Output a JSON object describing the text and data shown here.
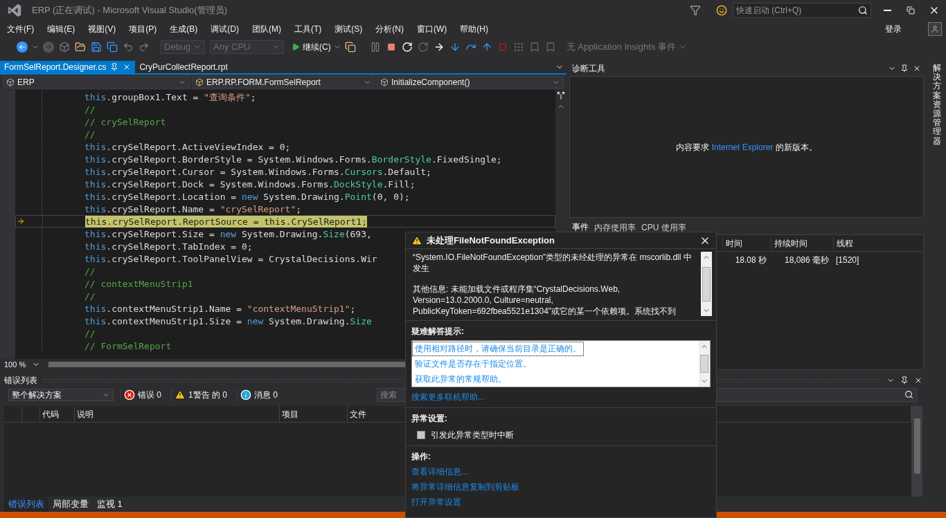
{
  "window": {
    "title": "ERP (正在调试) - Microsoft Visual Studio(管理员)",
    "quick_launch": {
      "placeholder": "快速启动 (Ctrl+Q)"
    }
  },
  "menu": {
    "items": [
      "文件(F)",
      "编辑(E)",
      "视图(V)",
      "项目(P)",
      "生成(B)",
      "调试(D)",
      "团队(M)",
      "工具(T)",
      "测试(S)",
      "分析(N)",
      "窗口(W)",
      "帮助(H)"
    ],
    "sign_in": "登录"
  },
  "toolbar": {
    "config": {
      "value": "Debug",
      "disabled": true
    },
    "platform": {
      "value": "Any CPU",
      "disabled": true
    },
    "continue": "继续(C)",
    "insights": {
      "value": "无 Application Insights 事件",
      "disabled": true
    }
  },
  "editor": {
    "tabs": [
      {
        "label": "FormSelReport.Designer.cs",
        "selected": true
      },
      {
        "label": "CryPurCollectReport.rpt",
        "selected": false
      }
    ],
    "nav": [
      "ERP",
      "ERP.RP.FORM.FormSelReport",
      "InitializeComponent()"
    ],
    "lines": [
      {
        "current": false,
        "tokens": [
          {
            "text": "this",
            "kind": "keyword"
          },
          {
            "text": ".groupBox1.Text = ",
            "kind": "plain"
          },
          {
            "text": "\"查询条件\"",
            "kind": "string"
          },
          {
            "text": ";",
            "kind": "plain"
          }
        ]
      },
      {
        "current": false,
        "tokens": [
          {
            "text": "//",
            "kind": "comment"
          }
        ]
      },
      {
        "current": false,
        "tokens": [
          {
            "text": "// crySelReport",
            "kind": "comment"
          }
        ]
      },
      {
        "current": false,
        "tokens": [
          {
            "text": "//",
            "kind": "comment"
          }
        ]
      },
      {
        "current": false,
        "tokens": [
          {
            "text": "this",
            "kind": "keyword"
          },
          {
            "text": ".crySelReport.ActiveViewIndex = 0;",
            "kind": "plain"
          }
        ]
      },
      {
        "current": false,
        "tokens": [
          {
            "text": "this",
            "kind": "keyword"
          },
          {
            "text": ".crySelReport.BorderStyle = System.Windows.Forms.",
            "kind": "plain"
          },
          {
            "text": "BorderStyle",
            "kind": "type"
          },
          {
            "text": ".FixedSingle;",
            "kind": "plain"
          }
        ]
      },
      {
        "current": false,
        "tokens": [
          {
            "text": "this",
            "kind": "keyword"
          },
          {
            "text": ".crySelReport.Cursor = System.Windows.Forms.",
            "kind": "plain"
          },
          {
            "text": "Cursors",
            "kind": "type"
          },
          {
            "text": ".Default;",
            "kind": "plain"
          }
        ]
      },
      {
        "current": false,
        "tokens": [
          {
            "text": "this",
            "kind": "keyword"
          },
          {
            "text": ".crySelReport.Dock = System.Windows.Forms.",
            "kind": "plain"
          },
          {
            "text": "DockStyle",
            "kind": "type"
          },
          {
            "text": ".Fill;",
            "kind": "plain"
          }
        ]
      },
      {
        "current": false,
        "tokens": [
          {
            "text": "this",
            "kind": "keyword"
          },
          {
            "text": ".crySelReport.Location = ",
            "kind": "plain"
          },
          {
            "text": "new",
            "kind": "keyword"
          },
          {
            "text": " System.Drawing.",
            "kind": "plain"
          },
          {
            "text": "Point",
            "kind": "type"
          },
          {
            "text": "(0, 0);",
            "kind": "plain"
          }
        ]
      },
      {
        "current": false,
        "tokens": [
          {
            "text": "this",
            "kind": "keyword"
          },
          {
            "text": ".crySelReport.Name = ",
            "kind": "plain"
          },
          {
            "text": "\"crySelReport\"",
            "kind": "string"
          },
          {
            "text": ";",
            "kind": "plain"
          }
        ]
      },
      {
        "current": true,
        "tokens": [
          {
            "text": "this",
            "kind": "keyword"
          },
          {
            "text": ".crySelReport.ReportSource = ",
            "kind": "plain"
          },
          {
            "text": "this",
            "kind": "keyword"
          },
          {
            "text": ".CrySelReport1;",
            "kind": "plain"
          }
        ]
      },
      {
        "current": false,
        "tokens": [
          {
            "text": "this",
            "kind": "keyword"
          },
          {
            "text": ".crySelReport.Size = ",
            "kind": "plain"
          },
          {
            "text": "new",
            "kind": "keyword"
          },
          {
            "text": " System.Drawing.",
            "kind": "plain"
          },
          {
            "text": "Size",
            "kind": "type"
          },
          {
            "text": "(693,",
            "kind": "plain"
          }
        ]
      },
      {
        "current": false,
        "tokens": [
          {
            "text": "this",
            "kind": "keyword"
          },
          {
            "text": ".crySelReport.TabIndex = 0;",
            "kind": "plain"
          }
        ]
      },
      {
        "current": false,
        "tokens": [
          {
            "text": "this",
            "kind": "keyword"
          },
          {
            "text": ".crySelReport.ToolPanelView = CrystalDecisions.Wir",
            "kind": "plain"
          }
        ]
      },
      {
        "current": false,
        "tokens": [
          {
            "text": "//",
            "kind": "comment"
          }
        ]
      },
      {
        "current": false,
        "tokens": [
          {
            "text": "// contextMenuStrip1",
            "kind": "comment"
          }
        ]
      },
      {
        "current": false,
        "tokens": [
          {
            "text": "//",
            "kind": "comment"
          }
        ]
      },
      {
        "current": false,
        "tokens": [
          {
            "text": "this",
            "kind": "keyword"
          },
          {
            "text": ".contextMenuStrip1.Name = ",
            "kind": "plain"
          },
          {
            "text": "\"contextMenuStrip1\"",
            "kind": "string"
          },
          {
            "text": ";",
            "kind": "plain"
          }
        ]
      },
      {
        "current": false,
        "tokens": [
          {
            "text": "this",
            "kind": "keyword"
          },
          {
            "text": ".contextMenuStrip1.Size = ",
            "kind": "plain"
          },
          {
            "text": "new",
            "kind": "keyword"
          },
          {
            "text": " System.Drawing.",
            "kind": "plain"
          },
          {
            "text": "Size",
            "kind": "type"
          }
        ]
      },
      {
        "current": false,
        "tokens": [
          {
            "text": "//",
            "kind": "comment"
          }
        ]
      },
      {
        "current": false,
        "tokens": [
          {
            "text": "// FormSelReport",
            "kind": "comment"
          }
        ]
      }
    ],
    "zoom": "100 %"
  },
  "diagnostics": {
    "title": "诊断工具",
    "message": {
      "before": "内容要求 ",
      "link": "Internet Explorer",
      "after": " 的新版本。"
    },
    "tabs": [
      {
        "label": "事件",
        "selected": true
      },
      {
        "label": "内存使用率",
        "selected": false
      },
      {
        "label": "CPU 使用率",
        "selected": false
      }
    ],
    "table": {
      "columns": [
        "时间",
        "持续时间",
        "线程"
      ],
      "rows": [
        [
          "18.08 秒",
          "18,086 毫秒",
          "[1520]"
        ]
      ]
    }
  },
  "error_list": {
    "title": "错误列表",
    "scope": "整个解决方案",
    "filters": [
      {
        "kind": "error",
        "label": "错误 0"
      },
      {
        "kind": "warning",
        "label": "1警告 的 0"
      },
      {
        "kind": "info",
        "label": "消息 0"
      }
    ],
    "search": {
      "placeholder": "搜索"
    },
    "columns": [
      "代码",
      "说明",
      "项目",
      "文件"
    ]
  },
  "bottom_tabs": [
    {
      "label": "错误列表",
      "selected": true
    },
    {
      "label": "局部变量",
      "selected": false
    },
    {
      "label": "监视 1",
      "selected": false
    }
  ],
  "side_strip": {
    "label": "解决方案资源管理器"
  },
  "exception": {
    "title": "未处理FileNotFoundException",
    "details": [
      "“System.IO.FileNotFoundException”类型的未经处理的异常在 mscorlib.dll 中发生",
      "其他信息: 未能加载文件或程序集“CrystalDecisions.Web, Version=13.0.2000.0, Culture=neutral, PublicKeyToken=692fbea5521e1304”或它的某一个依赖项。系统找不到"
    ],
    "tips_heading": "疑难解答提示:",
    "tips": [
      {
        "label": "使用相对路径时，请确保当前目录是正确的。",
        "selected": true
      },
      {
        "label": "验证文件是否存在于指定位置。",
        "selected": false
      },
      {
        "label": "获取此异常的常规帮助。",
        "selected": false
      }
    ],
    "more_help": "搜索更多联机帮助...",
    "settings_heading": "异常设置:",
    "break_option": {
      "label": "引发此异常类型时中断",
      "checked": false
    },
    "actions_heading": "操作:",
    "actions": [
      "查看详细信息...",
      "将异常详细信息复制到剪贴板",
      "打开异常设置"
    ]
  }
}
